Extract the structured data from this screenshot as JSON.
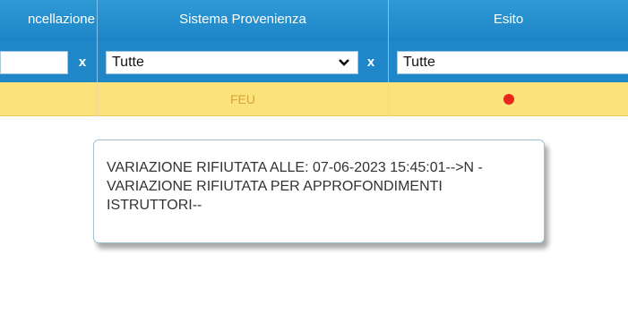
{
  "columns": {
    "cancellazione": "ncellazione",
    "sistema_provenienza": "Sistema Provenienza",
    "esito": "Esito"
  },
  "filters": {
    "cancellazione_value": "",
    "sistema_provenienza_value": "Tutte",
    "esito_value": "Tutte",
    "clear_label": "x"
  },
  "row": {
    "cancellazione": "",
    "sistema_provenienza": "FEU",
    "esito_status_color": "#e8261c"
  },
  "tooltip": {
    "text": "VARIAZIONE RIFIUTATA ALLE: 07-06-2023 15:45:01-->N - VARIAZIONE RIFIUTATA PER APPROFONDIMENTI ISTRUTTORI--"
  }
}
